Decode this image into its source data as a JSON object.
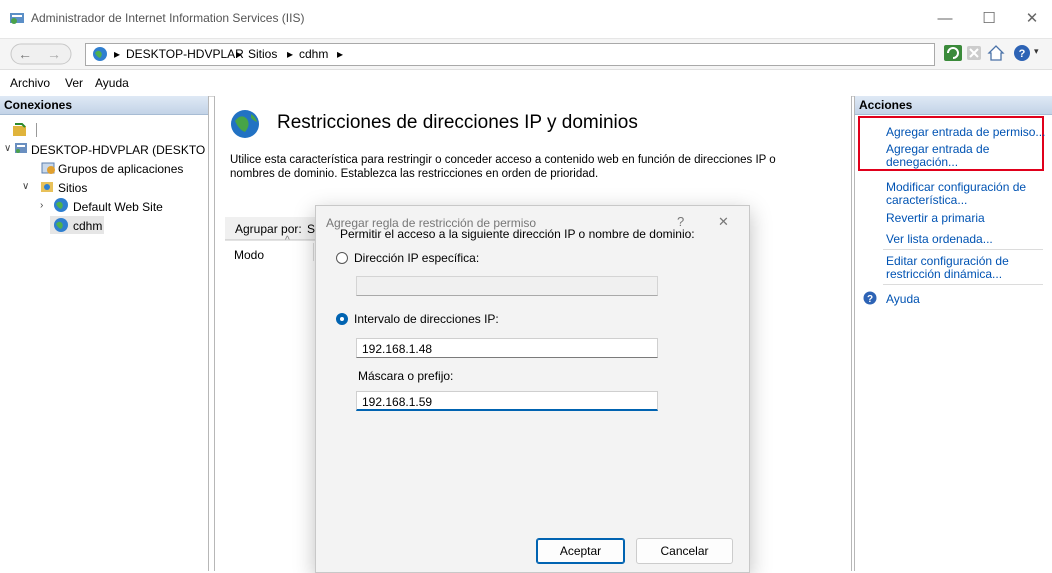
{
  "window": {
    "title": "Administrador de Internet Information Services (IIS)",
    "controls": [
      "minimize-icon",
      "maximize-icon",
      "close-icon"
    ]
  },
  "address": {
    "segments": [
      "DESKTOP-HDVPLAR",
      "Sitios",
      "cdhm"
    ],
    "separator": "▸"
  },
  "menu": {
    "items": [
      "Archivo",
      "Ver",
      "Ayuda"
    ]
  },
  "connections": {
    "header": "Conexiones",
    "tree": {
      "server": "DESKTOP-HDVPLAR (DESKTO",
      "app_pools": "Grupos de aplicaciones",
      "sites": "Sitios",
      "default_site": "Default Web Site",
      "selected_site": "cdhm"
    }
  },
  "feature": {
    "title": "Restricciones de direcciones IP y dominios",
    "description_line1": "Utilice esta característica para restringir o conceder acceso a contenido web en función de direcciones IP o",
    "description_line2": "nombres de dominio. Establezca las restricciones en orden de prioridad.",
    "group_by_label": "Agrupar por:",
    "group_by_value": "S",
    "column_mode": "Modo"
  },
  "dialog": {
    "title": "Agregar regla de restricción de permiso",
    "help_glyph": "?",
    "close_glyph": "✕",
    "prompt": "Permitir el acceso a la siguiente dirección IP o nombre de dominio:",
    "option_specific": "Dirección IP específica:",
    "specific_value": "",
    "option_range": "Intervalo de direcciones IP:",
    "range_value": "192.168.1.48",
    "mask_label": "Máscara o prefijo:",
    "mask_value": "192.168.1.59",
    "selected_option": "range",
    "ok": "Aceptar",
    "cancel": "Cancelar"
  },
  "actions": {
    "header": "Acciones",
    "add_allow": "Agregar entrada de permiso...",
    "add_deny_1": "Agregar entrada de",
    "add_deny_2": "denegación...",
    "edit_settings_1": "Modificar configuración de",
    "edit_settings_2": "característica...",
    "revert": "Revertir a primaria",
    "ordered_list": "Ver lista ordenada...",
    "dynamic_1": "Editar configuración de",
    "dynamic_2": "restricción dinámica...",
    "help": "Ayuda"
  },
  "colors": {
    "highlight_box": "#e0001b",
    "link": "#0053b3",
    "accent": "#0063b1"
  }
}
